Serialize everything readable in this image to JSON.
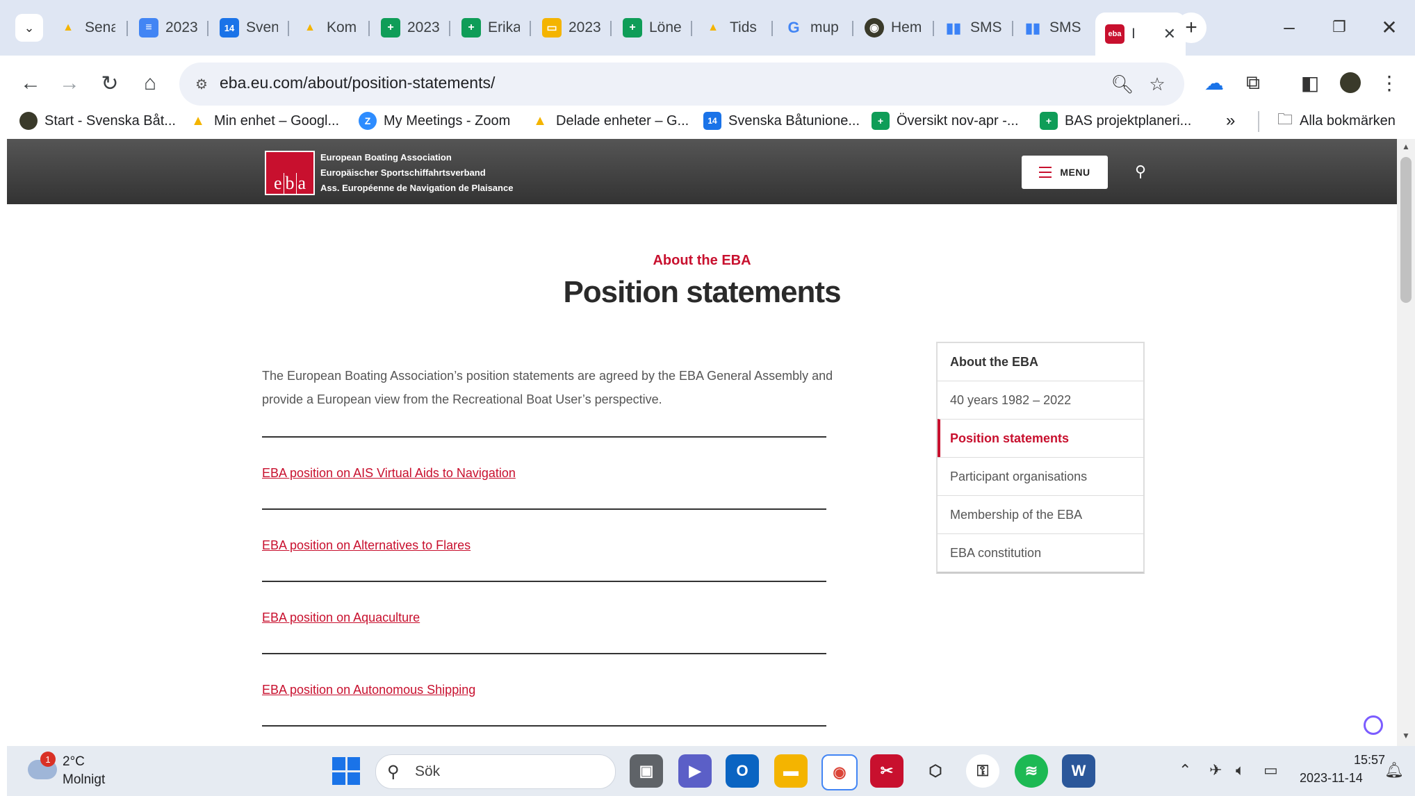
{
  "browser": {
    "tabs": [
      {
        "label": "Sena",
        "icon": "google-drive-icon",
        "color": "#f4b400"
      },
      {
        "label": "2023",
        "icon": "google-docs-icon",
        "color": "#4285f4"
      },
      {
        "label": "Sven",
        "icon": "calendar-icon",
        "color": "#1a73e8"
      },
      {
        "label": "Kom",
        "icon": "google-drive-icon",
        "color": "#f4b400"
      },
      {
        "label": "2023",
        "icon": "google-sheets-icon",
        "color": "#0f9d58"
      },
      {
        "label": "Erika",
        "icon": "google-sheets-icon",
        "color": "#0f9d58"
      },
      {
        "label": "2023",
        "icon": "google-slides-icon",
        "color": "#f4b400"
      },
      {
        "label": "Löne",
        "icon": "google-sheets-icon",
        "color": "#0f9d58"
      },
      {
        "label": "Tids",
        "icon": "google-drive-icon",
        "color": "#f4b400"
      },
      {
        "label": "mup",
        "icon": "google-icon",
        "color": "#4285f4"
      },
      {
        "label": "Hem",
        "icon": "club-emblem-icon",
        "color": "#3a3a2a"
      },
      {
        "label": "SMS",
        "icon": "sms-service-icon",
        "color": "#3b82f6"
      },
      {
        "label": "SMS",
        "icon": "sms-service-icon",
        "color": "#3b82f6"
      }
    ],
    "active_tab": {
      "label": "I",
      "icon": "eba-logo-icon",
      "color": "#c8102e"
    },
    "url": "eba.eu.com/about/position-statements/",
    "bookmarks": [
      {
        "label": "Start - Svenska Båt...",
        "icon": "club-emblem-icon",
        "color": "#3a3a2a"
      },
      {
        "label": "Min enhet – Googl...",
        "icon": "google-drive-icon",
        "color": "#f4b400"
      },
      {
        "label": "My Meetings - Zoom",
        "icon": "zoom-icon",
        "color": "#2d8cff"
      },
      {
        "label": "Delade enheter – G...",
        "icon": "google-drive-icon",
        "color": "#f4b400"
      },
      {
        "label": "Svenska Båtunione...",
        "icon": "calendar-icon",
        "color": "#1a73e8"
      },
      {
        "label": "Översikt nov-apr -...",
        "icon": "google-sheets-icon",
        "color": "#0f9d58"
      },
      {
        "label": "BAS projektplaneri...",
        "icon": "google-sheets-icon",
        "color": "#0f9d58"
      }
    ],
    "more_bookmarks": "»",
    "all_bookmarks": "Alla bokmärken"
  },
  "site": {
    "logo_letters": [
      "e",
      "b",
      "a"
    ],
    "logo_lines": [
      "European Boating Association",
      "Europäischer Sportschiffahrtsverband",
      "Ass. Européenne de Navigation de Plaisance"
    ],
    "menu_label": "MENU",
    "accent": "#c8102e"
  },
  "content": {
    "eyebrow": "About the EBA",
    "title": "Position statements",
    "intro": "The European Boating Association’s position statements are agreed by the EBA General Assembly and provide a European view from the Recreational Boat User’s perspective.",
    "statements": [
      "EBA position on AIS Virtual Aids to Navigation",
      "EBA position on Alternatives to Flares",
      "EBA position on Aquaculture",
      "EBA position on Autonomous Shipping"
    ]
  },
  "sidebar": {
    "items": [
      "About the EBA",
      "40 years 1982 – 2022",
      "Position statements",
      "Participant organisations",
      "Membership of the EBA",
      "EBA constitution"
    ],
    "active": "Position statements"
  },
  "taskbar": {
    "weather_badge": "1",
    "weather_temp": "2°C",
    "weather_desc": "Molnigt",
    "search_placeholder": "Sök",
    "time": "15:57",
    "date": "2023-11-14"
  }
}
